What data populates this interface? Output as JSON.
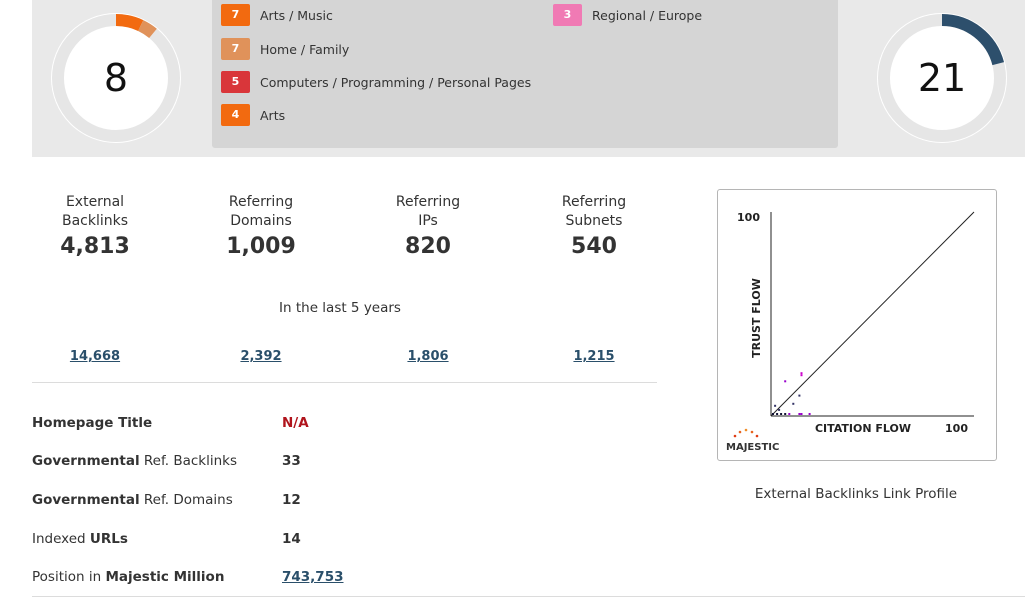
{
  "scores": {
    "left": {
      "value": "8",
      "segments": [
        {
          "fraction": 0.07,
          "color": "#f26a10"
        },
        {
          "fraction": 0.04,
          "color": "#e0925a"
        }
      ],
      "track_color": "#e6e6e6"
    },
    "right": {
      "value": "21",
      "segments": [
        {
          "fraction": 0.21,
          "color": "#2d4f6c"
        }
      ],
      "track_color": "#e6e6e6"
    }
  },
  "topics": [
    {
      "count": "7",
      "label": "Arts / Music",
      "color": "#f26a10"
    },
    {
      "count": "7",
      "label": "Home / Family",
      "color": "#e0925a"
    },
    {
      "count": "5",
      "label": "Computers / Programming / Personal Pages",
      "color": "#d9363a"
    },
    {
      "count": "4",
      "label": "Arts",
      "color": "#f26a10"
    },
    {
      "count": "3",
      "label": "Regional / Europe",
      "color": "#f07ab4"
    }
  ],
  "stats": [
    {
      "label": "External\nBacklinks",
      "value": "4,813",
      "historic": "14,668"
    },
    {
      "label": "Referring\nDomains",
      "value": "1,009",
      "historic": "2,392"
    },
    {
      "label": "Referring\nIPs",
      "value": "820",
      "historic": "1,806"
    },
    {
      "label": "Referring\nSubnets",
      "value": "540",
      "historic": "1,215"
    }
  ],
  "period_text": "In the last 5 years",
  "info": {
    "homepage_title": {
      "bold": "Homepage Title",
      "value": "N/A"
    },
    "gov_backlinks": {
      "bold": "Governmental",
      "rest": " Ref. Backlinks",
      "value": "33"
    },
    "gov_domains": {
      "bold": "Governmental",
      "rest": " Ref. Domains",
      "value": "12"
    },
    "indexed_urls": {
      "plain": "Indexed ",
      "bold": "URLs",
      "value": "14"
    },
    "majestic_million": {
      "plain": "Position in ",
      "bold": "Majestic Million",
      "value": "743,753"
    }
  },
  "flow_chart": {
    "y_axis_label": "TRUST FLOW",
    "x_axis_label": "CITATION FLOW",
    "y_max_label": "100",
    "x_max_label": "100",
    "logo_text": "MAJESTIC",
    "caption": "External Backlinks Link Profile",
    "axis_max": 100,
    "points": [
      {
        "cf": 15,
        "tf": 21,
        "color": "#cc00cc"
      },
      {
        "cf": 15,
        "tf": 20,
        "color": "#cc00cc"
      },
      {
        "cf": 7,
        "tf": 17,
        "color": "#9900cc"
      },
      {
        "cf": 14,
        "tf": 10,
        "color": "#333366"
      },
      {
        "cf": 11,
        "tf": 6,
        "color": "#333366"
      },
      {
        "cf": 2,
        "tf": 5,
        "color": "#333366"
      },
      {
        "cf": 4,
        "tf": 3,
        "color": "#333366"
      },
      {
        "cf": 1,
        "tf": 1,
        "color": "#111133"
      },
      {
        "cf": 3,
        "tf": 1,
        "color": "#111133"
      },
      {
        "cf": 5,
        "tf": 1,
        "color": "#111133"
      },
      {
        "cf": 7,
        "tf": 1,
        "color": "#111133"
      },
      {
        "cf": 9,
        "tf": 1,
        "color": "#9900cc"
      },
      {
        "cf": 14,
        "tf": 1,
        "color": "#9900cc"
      },
      {
        "cf": 15,
        "tf": 1,
        "color": "#9900cc"
      },
      {
        "cf": 19,
        "tf": 1,
        "color": "#9900cc"
      }
    ]
  }
}
